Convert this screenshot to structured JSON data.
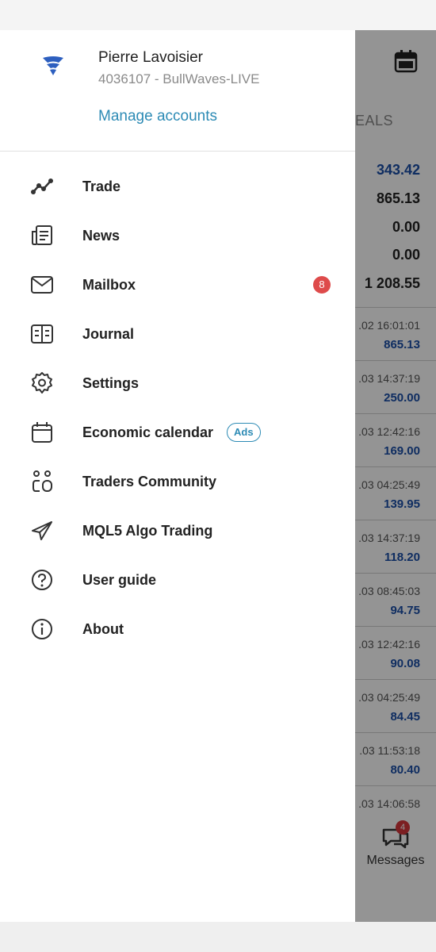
{
  "account": {
    "user_name": "Pierre Lavoisier",
    "account_line": "4036107 - BullWaves-LIVE",
    "manage_label": "Manage accounts"
  },
  "menu": {
    "items": [
      {
        "label": "Trade",
        "icon": "trade-chart-icon"
      },
      {
        "label": "News",
        "icon": "news-icon"
      },
      {
        "label": "Mailbox",
        "icon": "mail-icon",
        "badge": "8"
      },
      {
        "label": "Journal",
        "icon": "journal-icon"
      },
      {
        "label": "Settings",
        "icon": "gear-icon"
      },
      {
        "label": "Economic calendar",
        "icon": "calendar-icon",
        "pill": "Ads"
      },
      {
        "label": "Traders Community",
        "icon": "community-icon"
      },
      {
        "label": "MQL5 Algo Trading",
        "icon": "send-icon"
      },
      {
        "label": "User guide",
        "icon": "help-icon"
      },
      {
        "label": "About",
        "icon": "info-icon"
      }
    ]
  },
  "background": {
    "tab_label": "EALS",
    "summary": [
      "343.42",
      "865.13",
      "0.00",
      "0.00",
      "1 208.55"
    ],
    "deals": [
      {
        "time": ".02 16:01:01",
        "value": "865.13"
      },
      {
        "time": ".03 14:37:19",
        "value": "250.00"
      },
      {
        "time": ".03 12:42:16",
        "value": "169.00"
      },
      {
        "time": ".03 04:25:49",
        "value": "139.95"
      },
      {
        "time": ".03 14:37:19",
        "value": "118.20"
      },
      {
        "time": ".03 08:45:03",
        "value": "94.75"
      },
      {
        "time": ".03 12:42:16",
        "value": "90.08"
      },
      {
        "time": ".03 04:25:49",
        "value": "84.45"
      },
      {
        "time": ".03 11:53:18",
        "value": "80.40"
      },
      {
        "time": ".03 14:06:58",
        "value": ""
      }
    ],
    "messages_label": "Messages",
    "messages_badge": "4"
  },
  "colors": {
    "accent": "#2d8bb5",
    "badge_red": "#de4b4b",
    "deal_blue": "#1a4fa8"
  }
}
